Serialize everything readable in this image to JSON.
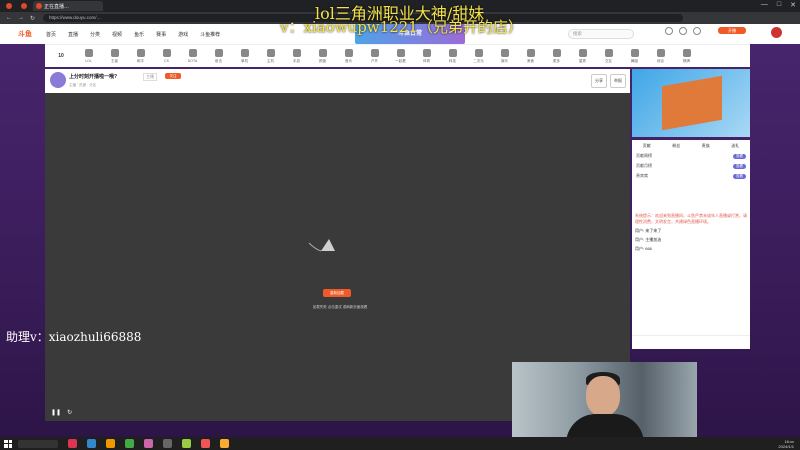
{
  "browser": {
    "active_tab": "正在直播…",
    "url": "https://www.douyu.com/…",
    "win_controls": [
      "—",
      "□",
      "✕"
    ]
  },
  "site": {
    "logo": "斗鱼",
    "nav": [
      "首页",
      "直播",
      "分类",
      "视频",
      "鱼乐",
      "赛事",
      "游戏",
      "斗鱼推荐"
    ],
    "banner": "斗鱼日常",
    "search_placeholder": "搜索",
    "open_btn": "开播"
  },
  "categories": {
    "count": "10",
    "items": [
      "LOL",
      "王者",
      "和平",
      "CS",
      "DOTA",
      "射击",
      "单机",
      "主机",
      "手游",
      "颜值",
      "音乐",
      "户外",
      "一起看",
      "体育",
      "科技",
      "二次元",
      "娱乐",
      "美食",
      "更多",
      "星秀",
      "交友",
      "舞蹈",
      "综合",
      "棋牌",
      "分类"
    ]
  },
  "room": {
    "title": "上分时刻开播啦一哦?",
    "tag": "主播",
    "follow": "关注",
    "meta": "主播 · 热度 · 分区",
    "buttons": [
      "分享",
      "举报"
    ],
    "error_button": "重新加载",
    "error_text": "加载失败 点击重试 或刷新页面观看"
  },
  "sidepanel": {
    "tabs": [
      "贡献",
      "粉丝",
      "贵族",
      "送礼"
    ],
    "rows": [
      {
        "label": "贡献周榜",
        "pill": "查看"
      },
      {
        "label": "贡献月榜",
        "pill": "查看"
      },
      {
        "label": "贵宾席",
        "pill": "查看"
      }
    ]
  },
  "chat": {
    "notice": "系统提示：欢迎来到直播间，斗鱼严禁未成年人直播或打赏，请理性消费，文明发言，共建绿色直播环境。",
    "messages": [
      "用户: 来了来了",
      "用户: 主播加油",
      "用户: 666"
    ]
  },
  "overlay": {
    "line1": "lol三角洲职业大神/甜妹",
    "line2": "v：xiaowupw1221（兄弟开的店）",
    "line3": "助理v：xiaozhuli66888"
  },
  "taskbar": {
    "time": "16:xx",
    "date": "2024/1/1"
  }
}
